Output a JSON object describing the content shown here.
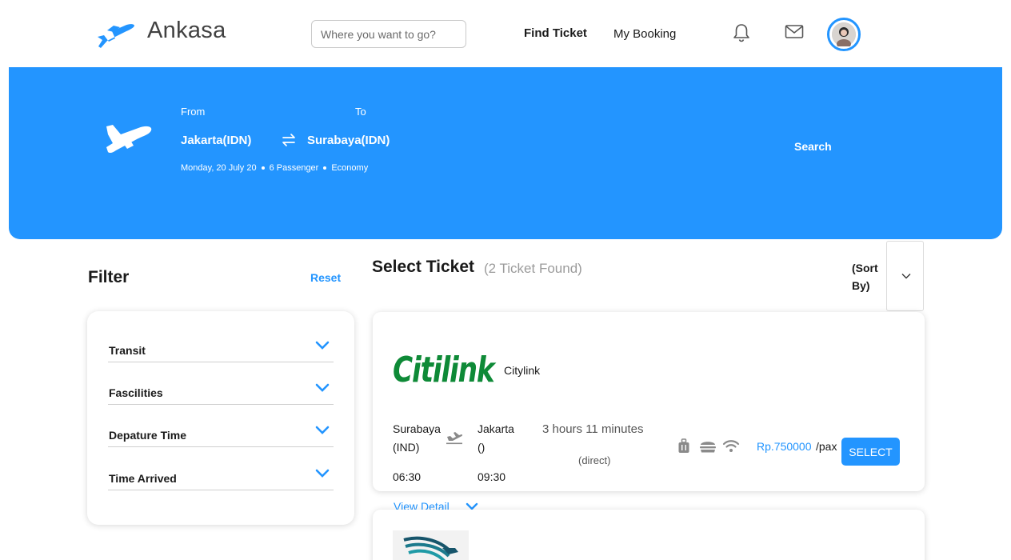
{
  "header": {
    "brand": "Ankasa",
    "search_placeholder": "Where you want to go?",
    "nav": {
      "find_ticket": "Find Ticket",
      "my_booking": "My Booking"
    },
    "icons": {
      "logo": "plane-icon",
      "notifications": "bell-icon",
      "messages": "mail-icon",
      "profile": "avatar"
    }
  },
  "hero": {
    "from_label": "From",
    "to_label": "To",
    "from_city": "Jakarta(IDN)",
    "to_city": "Surabaya(IDN)",
    "date": "Monday, 20 July 20",
    "passengers": "6 Passenger",
    "class": "Economy",
    "search_label": "Search",
    "background_color": "#2395ff"
  },
  "filter": {
    "title": "Filter",
    "reset": "Reset",
    "items": [
      {
        "label": "Transit"
      },
      {
        "label": "Fascilities"
      },
      {
        "label": "Depature Time"
      },
      {
        "label": "Time Arrived"
      }
    ]
  },
  "tickets": {
    "title": "Select Ticket",
    "count_text": "(2 Ticket Found)",
    "sort_label": "(Sort By)",
    "items": [
      {
        "logo_text": "Citilink",
        "airline": "Citylink",
        "departure_city": "Surabaya",
        "departure_code": "(IND)",
        "departure_time": "06:30",
        "arrival_city": "Jakarta",
        "arrival_code": "()",
        "arrival_time": "09:30",
        "duration": "3 hours 11 minutes",
        "stops": "(direct)",
        "facilities": [
          "luggage-icon",
          "food-icon",
          "wifi-icon"
        ],
        "price": "Rp.750000",
        "per": "/pax",
        "select_label": "SELECT"
      }
    ],
    "view_detail": "View Detail"
  },
  "colors": {
    "accent": "#2395ff",
    "citilink_green": "#0e8a37"
  }
}
